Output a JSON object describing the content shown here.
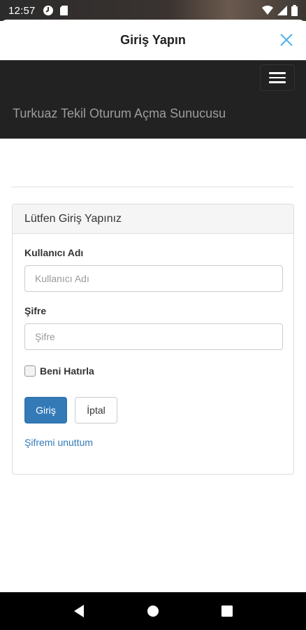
{
  "status_bar": {
    "time": "12:57"
  },
  "sheet": {
    "title": "Giriş Yapın"
  },
  "navbar": {
    "brand": "Turkuaz Tekil Oturum Açma Sunucusu"
  },
  "panel": {
    "heading": "Lütfen Giriş Yapınız",
    "username_label": "Kullanıcı Adı",
    "username_placeholder": "Kullanıcı Adı",
    "username_value": "",
    "password_label": "Şifre",
    "password_placeholder": "Şifre",
    "password_value": "",
    "remember_label": "Beni Hatırla",
    "remember_checked": false,
    "login_button": "Giriş",
    "cancel_button": "İptal",
    "forgot_link": "Şifremi unuttum"
  },
  "colors": {
    "accent": "#337ab7",
    "close_icon": "#4fb3e8",
    "navbar_bg": "#222222"
  }
}
